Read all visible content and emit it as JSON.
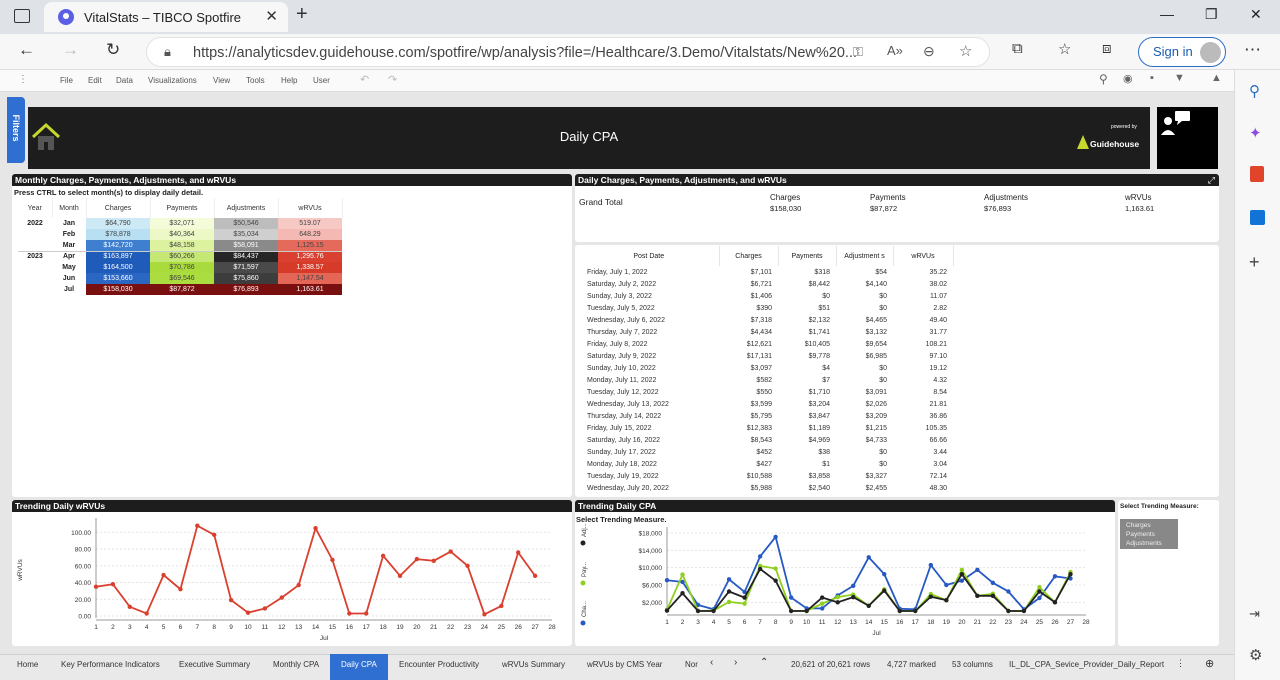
{
  "browser": {
    "tab_title": "VitalStats – TIBCO Spotfire",
    "url": "https://analyticsdev.guidehouse.com/spotfire/wp/analysis?file=/Healthcare/3.Demo/Vitalstats/New%20...",
    "signin_label": "Sign in"
  },
  "menu": [
    "File",
    "Edit",
    "Data",
    "Visualizations",
    "View",
    "Tools",
    "Help",
    "User"
  ],
  "filters_label": "Filters",
  "header": {
    "title": "Daily CPA",
    "powered_by": "powered by",
    "brand": "Guidehouse"
  },
  "monthly": {
    "title": "Monthly Charges, Payments, Adjustments, and wRVUs",
    "instruction": "Press CTRL to select month(s) to display daily detail.",
    "columns": [
      "Year",
      "Month",
      "Charges",
      "Payments",
      "Adjustments",
      "wRVUs"
    ],
    "rows": [
      {
        "year": "2022",
        "month": "Jan",
        "charges": "$64,790",
        "payments": "$32,071",
        "adjustments": "$50,546",
        "wrvus": "519.07",
        "c": "#cde9f6",
        "p": "#f4fbd8",
        "a": "#bdbdbd",
        "w": "#f7c9c4"
      },
      {
        "year": "",
        "month": "Feb",
        "charges": "$78,878",
        "payments": "$40,364",
        "adjustments": "$35,034",
        "wrvus": "648.29",
        "c": "#b9dff2",
        "p": "#ecf8c5",
        "a": "#cfcfcf",
        "w": "#f4b9b2"
      },
      {
        "year": "",
        "month": "Mar",
        "charges": "$142,720",
        "payments": "$48,158",
        "adjustments": "$58,091",
        "wrvus": "1,125.15",
        "c": "#3f7fcf",
        "p": "#dcf29e",
        "a": "#8a8a8a",
        "w": "#e56a5c"
      },
      {
        "year": "2023",
        "month": "Apr",
        "charges": "$163,897",
        "payments": "$60,266",
        "adjustments": "$84,437",
        "wrvus": "1,295.76",
        "c": "#1f5cba",
        "p": "#c4e873",
        "a": "#262626",
        "w": "#d9402f"
      },
      {
        "year": "",
        "month": "May",
        "charges": "$164,500",
        "payments": "$70,786",
        "adjustments": "$71,597",
        "wrvus": "1,338.57",
        "c": "#1f5cba",
        "p": "#a9db3c",
        "a": "#4a4a4a",
        "w": "#d63b2a"
      },
      {
        "year": "",
        "month": "Jun",
        "charges": "$153,660",
        "payments": "$69,546",
        "adjustments": "$75,860",
        "wrvus": "1,147.54",
        "c": "#2a66c2",
        "p": "#abdc40",
        "a": "#3d3d3d",
        "w": "#e36656"
      },
      {
        "year": "",
        "month": "Jul",
        "charges": "$158,030",
        "payments": "$87,872",
        "adjustments": "$76,893",
        "wrvus": "1,163.61",
        "c": "#7a0f0f",
        "p": "#7a0f0f",
        "a": "#7a0f0f",
        "w": "#7a0f0f"
      }
    ]
  },
  "daily": {
    "title": "Daily Charges, Payments, Adjustments, and wRVUs",
    "grand_total_label": "Grand Total",
    "totals": [
      {
        "label": "Charges",
        "value": "$158,030"
      },
      {
        "label": "Payments",
        "value": "$87,872"
      },
      {
        "label": "Adjustments",
        "value": "$76,893"
      },
      {
        "label": "wRVUs",
        "value": "1,163.61"
      }
    ],
    "columns": [
      "Post Date",
      "Charges",
      "Payments",
      "Adjustment s",
      "wRVUs"
    ],
    "rows": [
      [
        "Friday, July 1, 2022",
        "$7,101",
        "$318",
        "$54",
        "35.22"
      ],
      [
        "Saturday, July 2, 2022",
        "$6,721",
        "$8,442",
        "$4,140",
        "38.02"
      ],
      [
        "Sunday, July 3, 2022",
        "$1,406",
        "$0",
        "$0",
        "11.07"
      ],
      [
        "Tuesday, July 5, 2022",
        "$390",
        "$51",
        "$0",
        "2.82"
      ],
      [
        "Wednesday, July 6, 2022",
        "$7,318",
        "$2,132",
        "$4,465",
        "49.40"
      ],
      [
        "Thursday, July 7, 2022",
        "$4,434",
        "$1,741",
        "$3,132",
        "31.77"
      ],
      [
        "Friday, July 8, 2022",
        "$12,621",
        "$10,405",
        "$9,654",
        "108.21"
      ],
      [
        "Saturday, July 9, 2022",
        "$17,131",
        "$9,778",
        "$6,985",
        "97.10"
      ],
      [
        "Sunday, July 10, 2022",
        "$3,097",
        "$4",
        "$0",
        "19.12"
      ],
      [
        "Monday, July 11, 2022",
        "$582",
        "$7",
        "$0",
        "4.32"
      ],
      [
        "Tuesday, July 12, 2022",
        "$550",
        "$1,710",
        "$3,091",
        "8.54"
      ],
      [
        "Wednesday, July 13, 2022",
        "$3,599",
        "$3,204",
        "$2,026",
        "21.81"
      ],
      [
        "Thursday, July 14, 2022",
        "$5,795",
        "$3,847",
        "$3,209",
        "36.86"
      ],
      [
        "Friday, July 15, 2022",
        "$12,383",
        "$1,189",
        "$1,215",
        "105.35"
      ],
      [
        "Saturday, July 16, 2022",
        "$8,543",
        "$4,969",
        "$4,733",
        "66.66"
      ],
      [
        "Sunday, July 17, 2022",
        "$452",
        "$38",
        "$0",
        "3.44"
      ],
      [
        "Monday, July 18, 2022",
        "$427",
        "$1",
        "$0",
        "3.04"
      ],
      [
        "Tuesday, July 19, 2022",
        "$10,588",
        "$3,858",
        "$3,327",
        "72.14"
      ],
      [
        "Wednesday, July 20, 2022",
        "$5,988",
        "$2,540",
        "$2,455",
        "48.30"
      ]
    ]
  },
  "trend_wrvu": {
    "title": "Trending Daily wRVUs"
  },
  "trend_cpa": {
    "title": "Trending Daily CPA",
    "subtitle": "Select Trending Measure."
  },
  "measure_panel": {
    "title": "Select Trending Measure:",
    "options": [
      "Charges",
      "Payments",
      "Adjustments"
    ]
  },
  "chart_data": [
    {
      "type": "line",
      "title": "Trending Daily wRVUs",
      "ylabel": "wRVUs",
      "xlabel": "Jul",
      "ylim": [
        0,
        110
      ],
      "yticks": [
        "100.00",
        "80.00",
        "60.00",
        "40.00",
        "20.00",
        "0.00"
      ],
      "x": [
        1,
        2,
        3,
        4,
        5,
        6,
        7,
        8,
        9,
        10,
        11,
        12,
        13,
        14,
        15,
        16,
        17,
        18,
        19,
        20,
        21,
        22,
        23,
        24,
        25,
        26,
        27,
        28
      ],
      "series": [
        {
          "name": "wRVUs",
          "color": "#d9402f",
          "values": [
            35,
            38,
            11,
            3,
            49,
            32,
            108,
            97,
            19,
            4,
            9,
            22,
            37,
            105,
            67,
            3,
            3,
            72,
            48,
            68,
            66,
            77,
            60,
            2,
            12,
            76,
            48
          ]
        }
      ]
    },
    {
      "type": "line",
      "title": "Trending Daily CPA",
      "xlabel": "Jul",
      "ylim": [
        0,
        18000
      ],
      "yticks": [
        "$18,000",
        "$14,000",
        "$10,000",
        "$6,000",
        "$2,000"
      ],
      "legend": [
        "Adj...",
        "Pay...",
        "Cha..."
      ],
      "x": [
        1,
        2,
        3,
        4,
        5,
        6,
        7,
        8,
        9,
        10,
        11,
        12,
        13,
        14,
        15,
        16,
        17,
        18,
        19,
        20,
        21,
        22,
        23,
        24,
        25,
        26,
        27,
        28
      ],
      "series": [
        {
          "name": "Cha...",
          "color": "#2759c4",
          "values": [
            7100,
            6700,
            1400,
            400,
            7300,
            4400,
            12600,
            17100,
            3100,
            600,
            600,
            3600,
            5800,
            12400,
            8500,
            500,
            400,
            10600,
            6000,
            7000,
            9500,
            6500,
            4500,
            400,
            3000,
            8000,
            7500
          ]
        },
        {
          "name": "Pay...",
          "color": "#8fcf1f",
          "values": [
            300,
            8400,
            0,
            100,
            2100,
            1700,
            10400,
            9800,
            0,
            0,
            1700,
            3200,
            3800,
            1200,
            5000,
            0,
            0,
            3900,
            2500,
            9500,
            3500,
            4000,
            0,
            0,
            5500,
            2000,
            9000
          ]
        },
        {
          "name": "Adj...",
          "color": "#222222",
          "values": [
            100,
            4100,
            0,
            0,
            4500,
            3100,
            9700,
            7000,
            0,
            0,
            3100,
            2000,
            3200,
            1200,
            4700,
            0,
            0,
            3300,
            2500,
            8500,
            3500,
            3500,
            0,
            0,
            4500,
            2000,
            8500
          ]
        }
      ]
    }
  ],
  "bottom_tabs": [
    "Home",
    "Key Performance Indicators",
    "Executive Summary",
    "Monthly CPA",
    "Daily CPA",
    "Encounter Productivity",
    "wRVUs Summary",
    "wRVUs by CMS Year",
    "Nor"
  ],
  "status": {
    "rows": "20,621 of 20,621 rows",
    "marked": "4,727 marked",
    "columns": "53 columns",
    "table": "IL_DL_CPA_Sevice_Provider_Daily_Report"
  }
}
